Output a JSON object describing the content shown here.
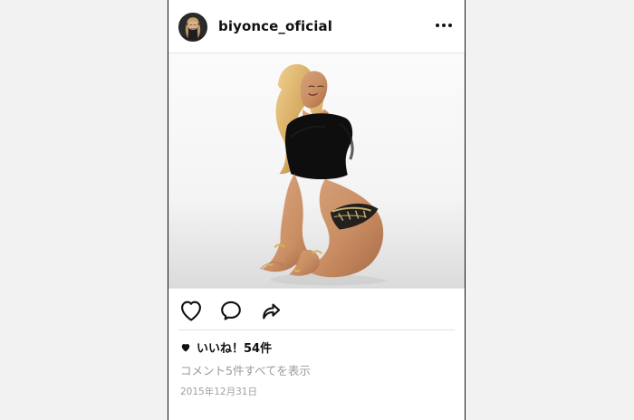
{
  "post": {
    "username": "biyonce_oficial",
    "likes_text": "いいね！54件",
    "view_comments_text": "コメント5件すべてを表示",
    "date_text": "2015年12月31日",
    "likes_count": 54,
    "comments_count": 5
  },
  "icons": {
    "avatar": "avatar-icon",
    "more": "more-options-icon",
    "like": "heart-icon",
    "comment": "comment-icon",
    "share": "share-icon",
    "like_small": "heart-filled-icon"
  },
  "colors": {
    "text_primary": "#111111",
    "text_secondary": "#9a9a9a",
    "border": "#111111",
    "background": "#f2f2f2",
    "card_background": "#ffffff"
  }
}
